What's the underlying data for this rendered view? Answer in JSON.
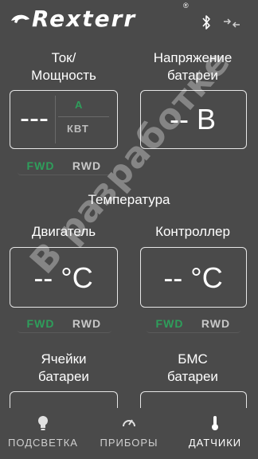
{
  "header": {
    "brand": "Rexterr",
    "reg_mark": "®",
    "bluetooth_icon": "bluetooth-icon",
    "connection_icon": "connection-arrows-icon"
  },
  "power": {
    "label_line1": "Ток/",
    "label_line2": "Мощность",
    "value": "---",
    "unit_amp": "A",
    "unit_kw": "КВТ"
  },
  "battery_voltage": {
    "label_line1": "Напряжение",
    "label_line2": "батареи",
    "value": "-- В"
  },
  "direction_1": {
    "fwd": "FWD",
    "rwd": "RWD"
  },
  "temperature": {
    "section_title": "Температура",
    "motor_label": "Двигатель",
    "motor_value": "-- °C",
    "controller_label": "Контроллер",
    "controller_value": "-- °C"
  },
  "direction_2": {
    "fwd": "FWD",
    "rwd": "RWD"
  },
  "direction_3": {
    "fwd": "FWD",
    "rwd": "RWD"
  },
  "cells": {
    "label_line1": "Ячейки",
    "label_line2": "батареи"
  },
  "bms": {
    "label_line1": "БМС",
    "label_line2": "батареи"
  },
  "watermark": "В разработке",
  "nav": {
    "items": [
      {
        "label": "ПОДСВЕТКА",
        "icon": "lightbulb-icon"
      },
      {
        "label": "ПРИБОРЫ",
        "icon": "gauge-icon"
      },
      {
        "label": "ДАТЧИКИ",
        "icon": "thermometer-icon"
      }
    ],
    "active": "ДАТЧИКИ"
  },
  "colors": {
    "background": "#4a4a4a",
    "accent_green": "#2e9e5b",
    "border": "#e6e6e6"
  }
}
